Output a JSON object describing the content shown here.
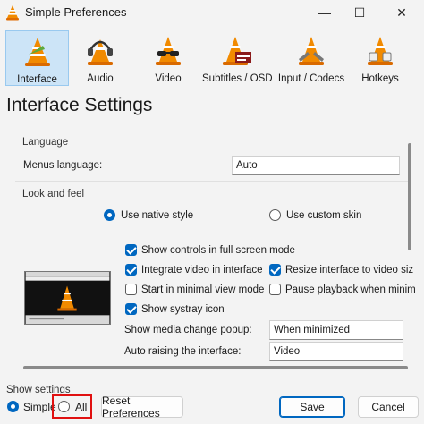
{
  "window": {
    "title": "Simple Preferences",
    "minimize_glyph": "—",
    "maximize_glyph": "☐",
    "close_glyph": "✕"
  },
  "categories": [
    {
      "label": "Interface",
      "icon": "interface-cone-icon",
      "selected": true
    },
    {
      "label": "Audio",
      "icon": "headphones-cone-icon",
      "selected": false
    },
    {
      "label": "Video",
      "icon": "glasses-cone-icon",
      "selected": false
    },
    {
      "label": "Subtitles / OSD",
      "icon": "subtitles-cone-icon",
      "selected": false
    },
    {
      "label": "Input / Codecs",
      "icon": "codec-cone-icon",
      "selected": false
    },
    {
      "label": "Hotkeys",
      "icon": "hotkeys-cone-icon",
      "selected": false
    }
  ],
  "page_title": "Interface Settings",
  "language": {
    "section": "Language",
    "menus_label": "Menus language:",
    "menus_value": "Auto"
  },
  "look_and_feel": {
    "section": "Look and feel",
    "style_options": [
      {
        "label": "Use native style",
        "selected": true
      },
      {
        "label": "Use custom skin",
        "selected": false
      }
    ],
    "checkboxes": {
      "show_controls_fullscreen": {
        "label": "Show controls in full screen mode",
        "checked": true
      },
      "integrate_video": {
        "label": "Integrate video in interface",
        "checked": true
      },
      "resize_interface": {
        "label": "Resize interface to video siz",
        "checked": true
      },
      "minimal_view": {
        "label": "Start in minimal view mode",
        "checked": false
      },
      "pause_playback": {
        "label": "Pause playback when minim",
        "checked": false
      },
      "systray_icon": {
        "label": "Show systray icon",
        "checked": true
      }
    },
    "media_change_popup": {
      "label": "Show media change popup:",
      "value": "When minimized"
    },
    "auto_raising": {
      "label": "Auto raising the interface:",
      "value": "Video"
    }
  },
  "footer": {
    "show_settings_label": "Show settings",
    "simple_label": "Simple",
    "all_label": "All",
    "simple_selected": true,
    "reset_label": "Reset Preferences",
    "save_label": "Save",
    "cancel_label": "Cancel"
  },
  "colors": {
    "accent": "#0067c0",
    "selected_category_bg": "#cce4f7",
    "cone_orange": "#f18a00",
    "highlight_box": "#e01010"
  }
}
